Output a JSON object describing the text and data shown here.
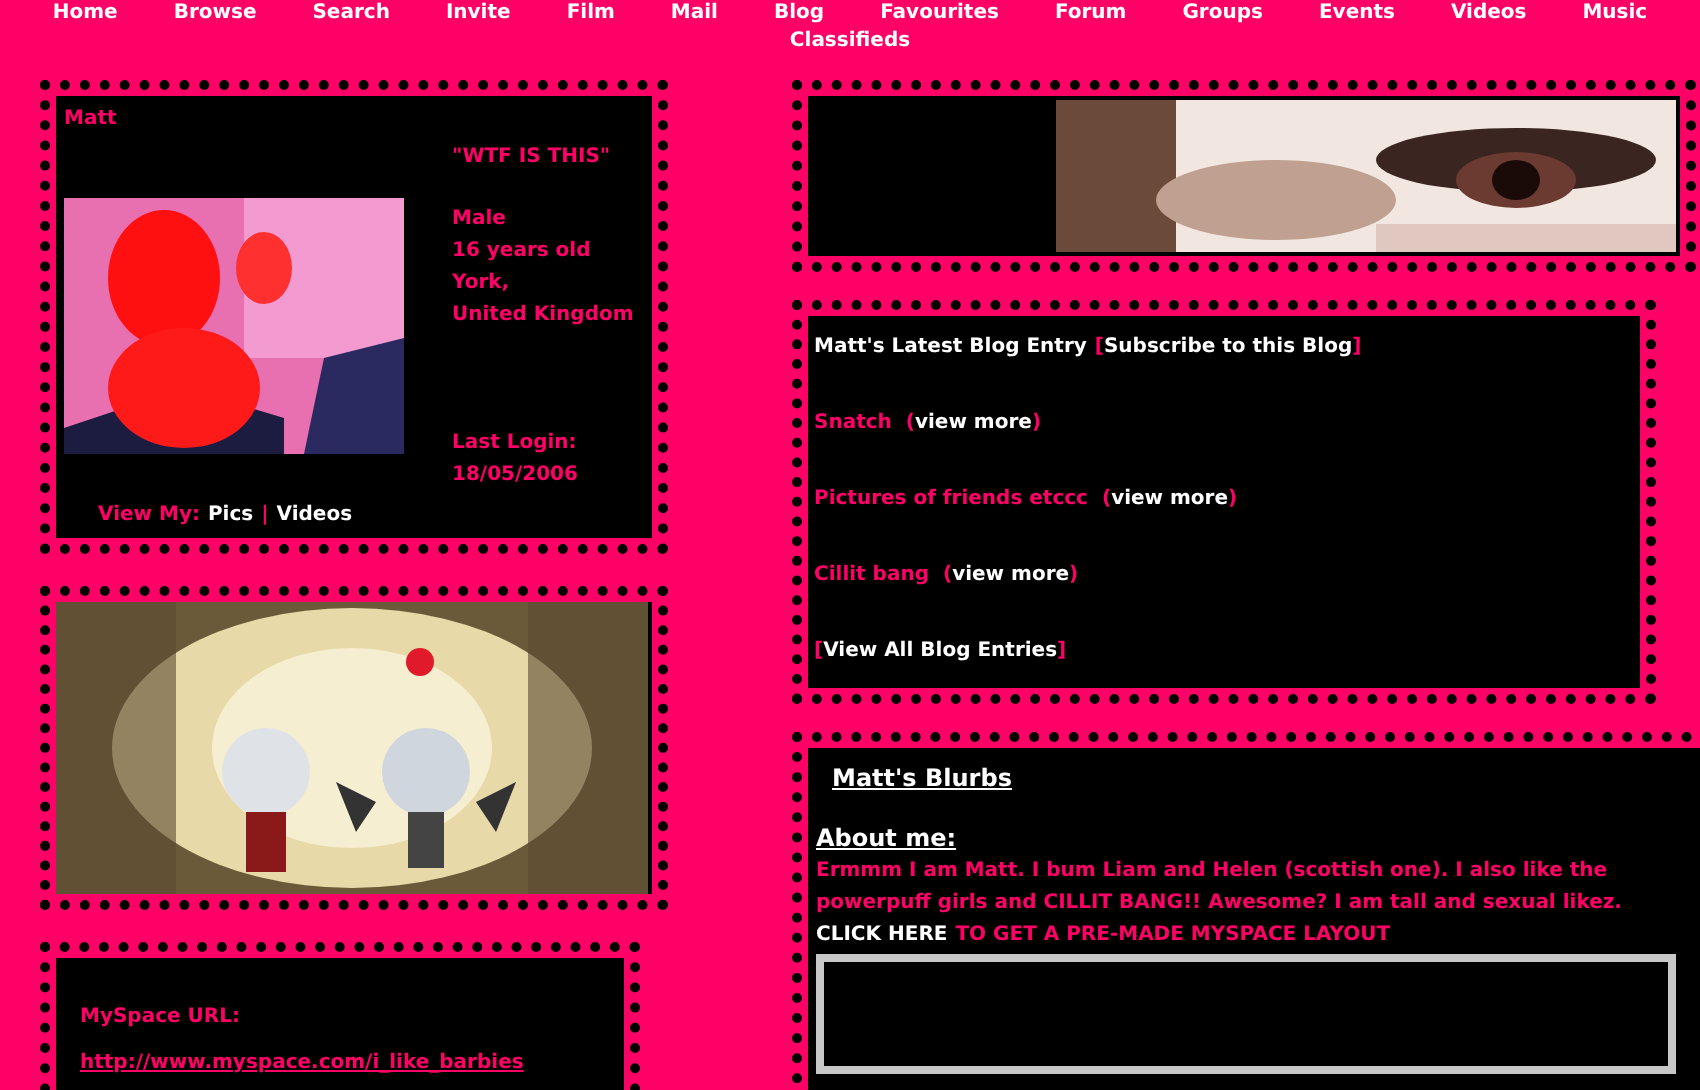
{
  "nav": [
    "Home",
    "Browse",
    "Search",
    "Invite",
    "Film",
    "Mail",
    "Blog",
    "Favourites",
    "Forum",
    "Groups",
    "Events",
    "Videos",
    "Music",
    "Classifieds"
  ],
  "profile": {
    "name": "Matt",
    "headline": "\"WTF IS THIS\"",
    "details": [
      "Male",
      "16 years old",
      "York,",
      "United Kingdom"
    ],
    "last_login_label": "Last Login:",
    "last_login": "18/05/2006",
    "view_my": "View My:",
    "links": [
      "Pics",
      "Videos"
    ],
    "separator": "|"
  },
  "url_box": {
    "label": "MySpace URL:",
    "url": "http://www.myspace.com/i_like_barbies"
  },
  "blog": {
    "brackets": [
      "[",
      "]"
    ],
    "parens": [
      "(",
      ")"
    ],
    "title": "Matt's Latest Blog Entry",
    "subscribe": "Subscribe to this Blog",
    "entries": [
      {
        "title": "Snatch",
        "more": "view more"
      },
      {
        "title": "Pictures of friends etccc",
        "more": "view more"
      },
      {
        "title": "Cillit bang",
        "more": "view more"
      }
    ],
    "view_all": "View All Blog Entries"
  },
  "blurbs": {
    "title": "Matt's Blurbs",
    "about_label": "About me:",
    "about": "Ermmm I am Matt. I bum Liam and Helen (scottish one). I also like the powerpuff girls and CILLIT BANG!! Awesome? I am tall and sexual likez.",
    "click_here": "CLICK HERE",
    "layout_link": "TO GET A PRE-MADE MYSPACE LAYOUT"
  }
}
